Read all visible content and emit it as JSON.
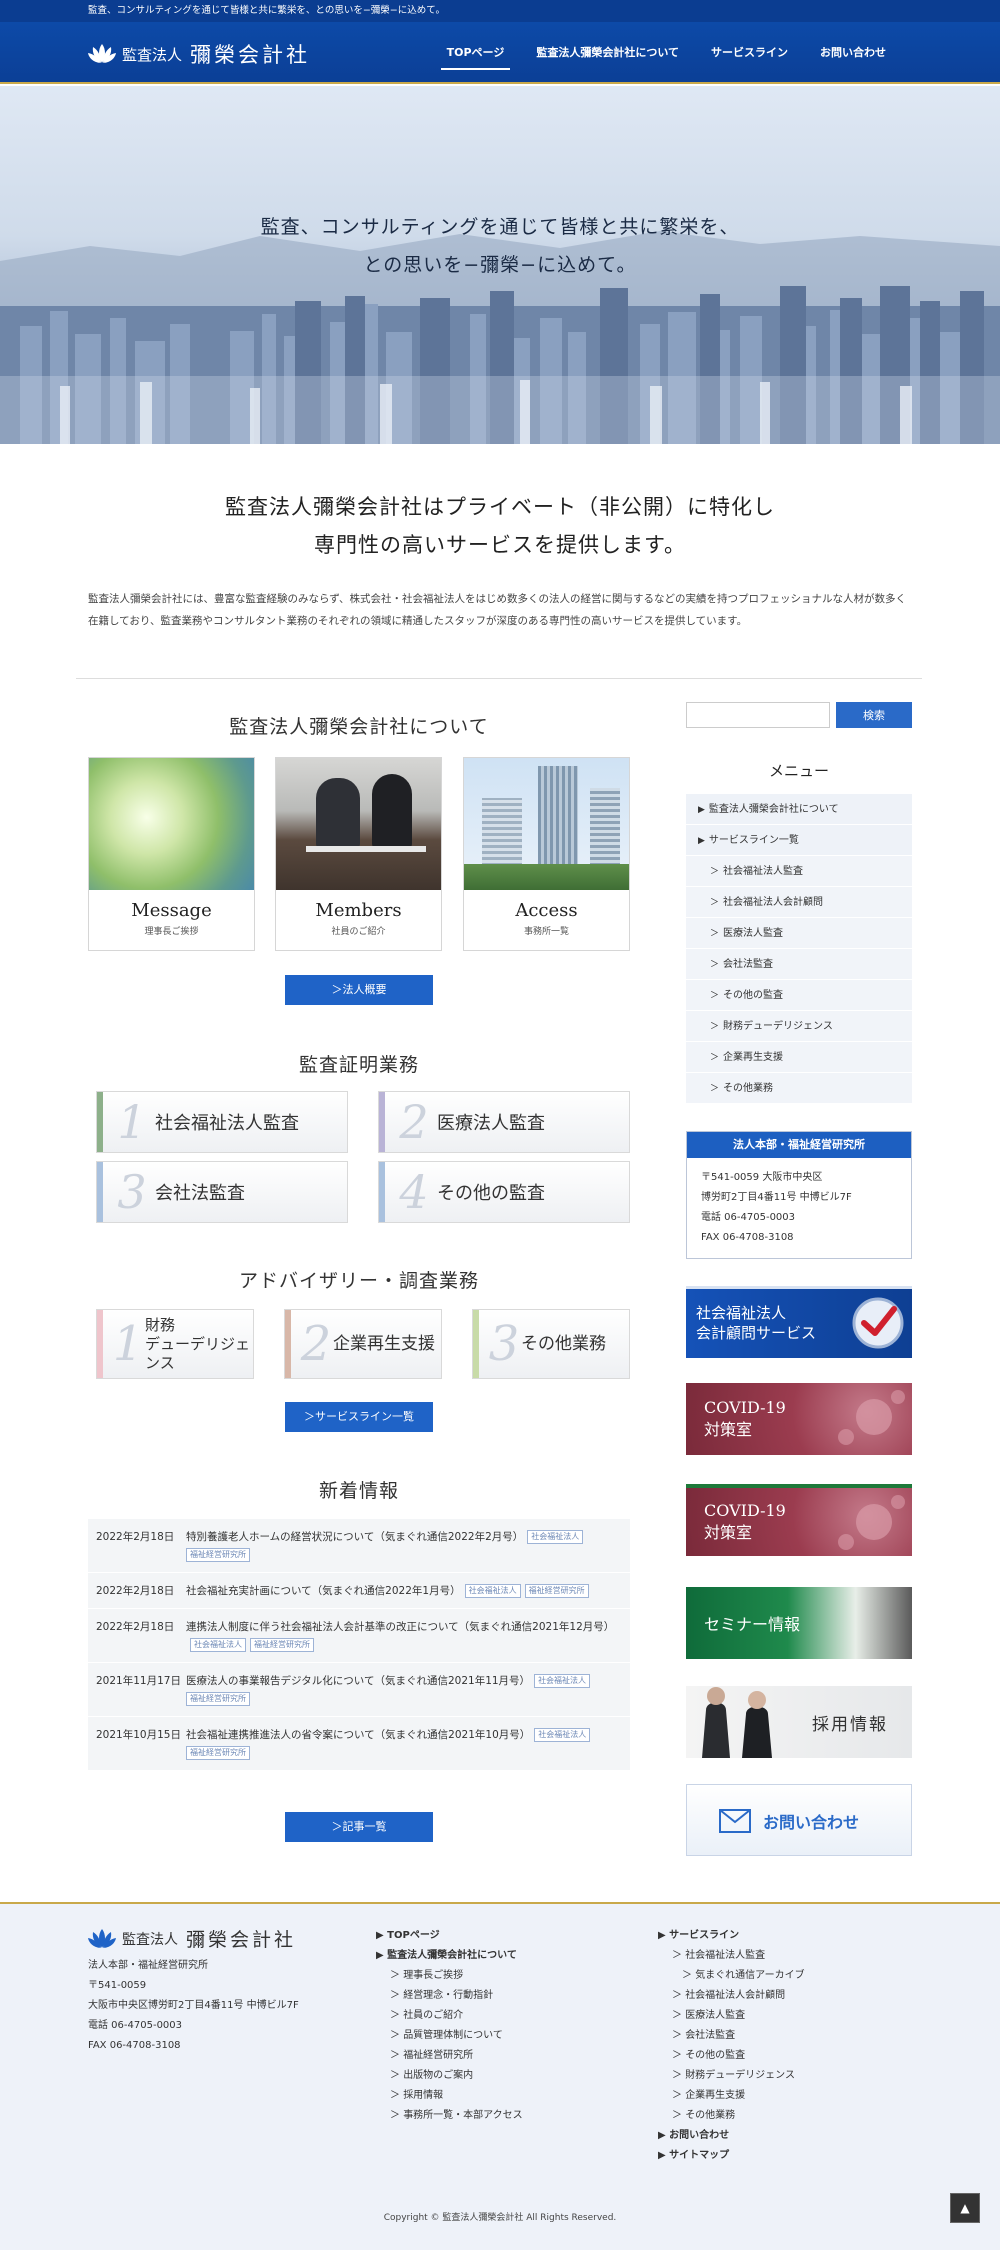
{
  "topbar": {
    "text": "監査、コンサルティングを通じて皆様と共に繁栄を、との思いを−彌榮−に込めて。"
  },
  "header": {
    "logo_small": "監査法人",
    "logo_big": "彌榮会計社",
    "nav": [
      {
        "label": "TOPページ"
      },
      {
        "label": "監査法人彌榮会計社について"
      },
      {
        "label": "サービスライン"
      },
      {
        "label": "お問い合わせ"
      }
    ]
  },
  "hero": {
    "line1": "監査、コンサルティングを通じて皆様と共に繁栄を、",
    "line2": "との思いを−彌榮−に込めて。"
  },
  "intro": {
    "title1": "監査法人彌榮会計社はプライベート（非公開）に特化し",
    "title2": "専門性の高いサービスを提供します。",
    "text": "監査法人彌榮会計社には、豊富な監査経験のみならず、株式会社・社会福祉法人をはじめ数多くの法人の経営に関与するなどの実績を持つプロフェッショナルな人材が数多く在籍しており、監査業務やコンサルタント業務のそれぞれの領域に精通したスタッフが深度のある専門性の高いサービスを提供しています。"
  },
  "about": {
    "title": "監査法人彌榮会計社について",
    "cards": [
      {
        "title": "Message",
        "sub": "理事長ご挨拶"
      },
      {
        "title": "Members",
        "sub": "社員のご紹介"
      },
      {
        "title": "Access",
        "sub": "事務所一覧"
      }
    ],
    "button": "＞法人概要"
  },
  "audit": {
    "title": "監査証明業務",
    "items": [
      {
        "num": "1",
        "label": "社会福祉法人監査",
        "color": "#8db08a"
      },
      {
        "num": "2",
        "label": "医療法人監査",
        "color": "#b9b3d6"
      },
      {
        "num": "3",
        "label": "会社法監査",
        "color": "#a9c1de"
      },
      {
        "num": "4",
        "label": "その他の監査",
        "color": "#a9c1de"
      }
    ]
  },
  "advisory": {
    "title": "アドバイザリー・調査業務",
    "items": [
      {
        "num": "1",
        "label1": "財務",
        "label2": "デューデリジェンス",
        "color": "#efc5cc"
      },
      {
        "num": "2",
        "label1": "企業再生支援",
        "label2": "",
        "color": "#d8b7a8"
      },
      {
        "num": "3",
        "label1": "その他業務",
        "label2": "",
        "color": "#c8dba8"
      }
    ],
    "button": "＞サービスライン一覧"
  },
  "news": {
    "title": "新着情報",
    "items": [
      {
        "date": "2022年2月18日",
        "text": "特別養護老人ホームの経営状況について（気まぐれ通信2022年2月号）",
        "tags": [
          "社会福祉法人",
          "福祉経営研究所"
        ]
      },
      {
        "date": "2022年2月18日",
        "text": "社会福祉充実計画について（気まぐれ通信2022年1月号）",
        "tags": [
          "社会福祉法人",
          "福祉経営研究所"
        ]
      },
      {
        "date": "2022年2月18日",
        "text": "連携法人制度に伴う社会福祉法人会計基準の改正について（気まぐれ通信2021年12月号）",
        "tags": [
          "社会福祉法人",
          "福祉経営研究所"
        ]
      },
      {
        "date": "2021年11月17日",
        "text": "医療法人の事業報告デジタル化について（気まぐれ通信2021年11月号）",
        "tags": [
          "社会福祉法人",
          "福祉経営研究所"
        ]
      },
      {
        "date": "2021年10月15日",
        "text": "社会福祉連携推進法人の省令案について（気まぐれ通信2021年10月号）",
        "tags": [
          "社会福祉法人",
          "福祉経営研究所"
        ]
      }
    ],
    "button": "＞記事一覧"
  },
  "sidebar": {
    "search_button": "検索",
    "search_placeholder": "",
    "menu_title": "メニュー",
    "menu": [
      {
        "label": "監査法人彌榮会計社について",
        "sub": false
      },
      {
        "label": "サービスライン一覧",
        "sub": false
      },
      {
        "label": "社会福祉法人監査",
        "sub": true
      },
      {
        "label": "社会福祉法人会計顧問",
        "sub": true
      },
      {
        "label": "医療法人監査",
        "sub": true
      },
      {
        "label": "会社法監査",
        "sub": true
      },
      {
        "label": "その他の監査",
        "sub": true
      },
      {
        "label": "財務デューデリジェンス",
        "sub": true
      },
      {
        "label": "企業再生支援",
        "sub": true
      },
      {
        "label": "その他業務",
        "sub": true
      }
    ],
    "office": {
      "head": "法人本部・福祉経営研究所",
      "zip": "〒541-0059 大阪市中央区",
      "addr": "博労町2丁目4番11号 中博ビル7F",
      "tel": "電話 06-4705-0003",
      "fax": "FAX 06-4708-3108"
    },
    "banners": {
      "welfare1": "社会福祉法人",
      "welfare2": "会計顧問サービス",
      "covid1a": "COVID-19",
      "covid1b": "対策室",
      "covid2a": "COVID-19",
      "covid2b": "対策室",
      "seminar": "セミナー情報",
      "recruit": "採用情報",
      "contact": "お問い合わせ"
    }
  },
  "footer": {
    "logo_small": "監査法人",
    "logo_big": "彌榮会計社",
    "info": [
      "法人本部・福祉経営研究所",
      "〒541-0059",
      "大阪市中央区博労町2丁目4番11号 中博ビル7F",
      "電話 06-4705-0003",
      "FAX 06-4708-3108"
    ],
    "col1": [
      {
        "label": "TOPページ",
        "lvl": 0
      },
      {
        "label": "監査法人彌榮会計社について",
        "lvl": 0
      },
      {
        "label": "理事長ご挨拶",
        "lvl": 1
      },
      {
        "label": "経営理念・行動指針",
        "lvl": 1
      },
      {
        "label": "社員のご紹介",
        "lvl": 1
      },
      {
        "label": "品質管理体制について",
        "lvl": 1
      },
      {
        "label": "福祉経営研究所",
        "lvl": 1
      },
      {
        "label": "出版物のご案内",
        "lvl": 1
      },
      {
        "label": "採用情報",
        "lvl": 1
      },
      {
        "label": "事務所一覧・本部アクセス",
        "lvl": 1
      }
    ],
    "col2": [
      {
        "label": "サービスライン",
        "lvl": 0
      },
      {
        "label": "社会福祉法人監査",
        "lvl": 1
      },
      {
        "label": "気まぐれ通信アーカイブ",
        "lvl": 2
      },
      {
        "label": "社会福祉法人会計顧問",
        "lvl": 1
      },
      {
        "label": "医療法人監査",
        "lvl": 1
      },
      {
        "label": "会社法監査",
        "lvl": 1
      },
      {
        "label": "その他の監査",
        "lvl": 1
      },
      {
        "label": "財務デューデリジェンス",
        "lvl": 1
      },
      {
        "label": "企業再生支援",
        "lvl": 1
      },
      {
        "label": "その他業務",
        "lvl": 1
      },
      {
        "label": "お問い合わせ",
        "lvl": 0
      },
      {
        "label": "サイトマップ",
        "lvl": 0
      }
    ],
    "copyright": "Copyright © 監査法人彌榮会計社 All Rights Reserved."
  }
}
